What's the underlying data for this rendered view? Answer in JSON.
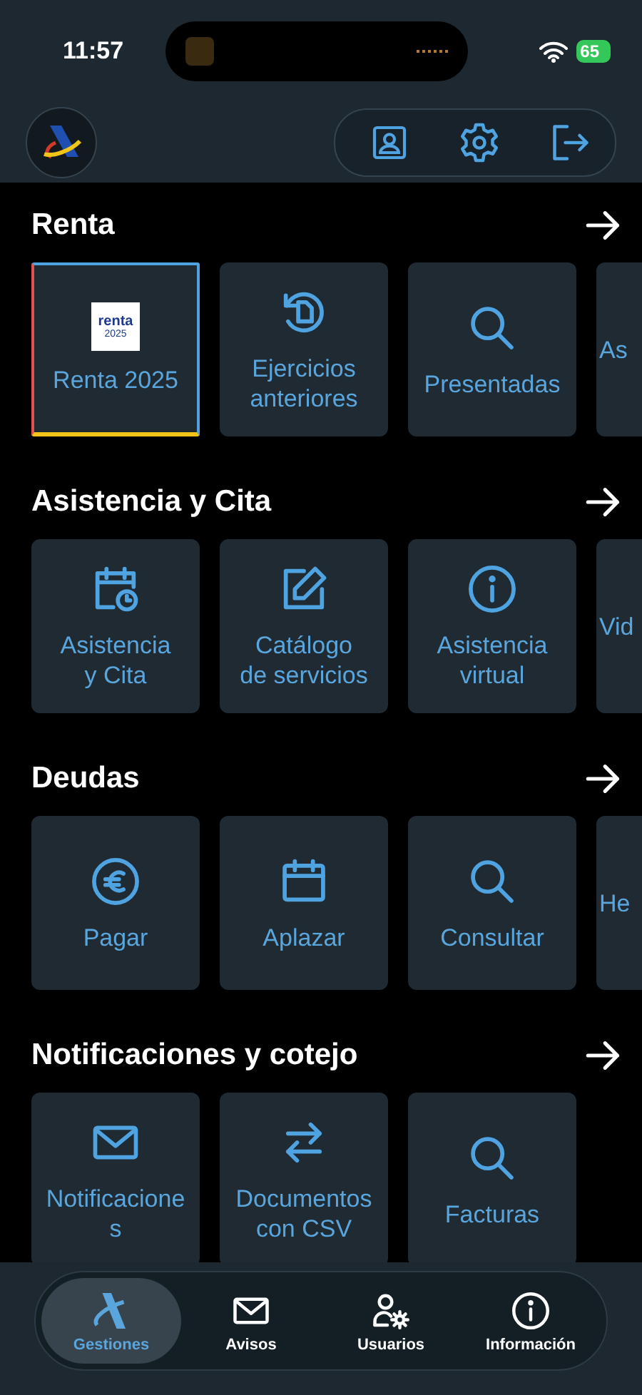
{
  "status_bar": {
    "time": "11:57",
    "battery": "65"
  },
  "sections": [
    {
      "title": "Renta",
      "tiles": [
        {
          "kind": "renta-logo",
          "logo": {
            "title": "renta",
            "year": "2025"
          },
          "lines": [
            "Renta 2025"
          ],
          "highlighted": true
        },
        {
          "kind": "history",
          "lines": [
            "Ejercicios",
            "anteriores"
          ],
          "highlighted": false
        },
        {
          "kind": "search",
          "lines": [
            "Presentadas"
          ],
          "highlighted": false
        },
        {
          "kind": "partial",
          "lines": [
            "As"
          ],
          "highlighted": false
        }
      ]
    },
    {
      "title": "Asistencia y Cita",
      "tiles": [
        {
          "kind": "calendar-clock",
          "lines": [
            "Asistencia",
            "y Cita"
          ],
          "highlighted": false
        },
        {
          "kind": "edit",
          "lines": [
            "Catálogo",
            "de servicios"
          ],
          "highlighted": false
        },
        {
          "kind": "info",
          "lines": [
            "Asistencia",
            "virtual"
          ],
          "highlighted": false
        },
        {
          "kind": "partial",
          "lines": [
            "Vid"
          ],
          "highlighted": false
        }
      ]
    },
    {
      "title": "Deudas",
      "tiles": [
        {
          "kind": "euro",
          "lines": [
            "Pagar"
          ],
          "highlighted": false
        },
        {
          "kind": "calendar",
          "lines": [
            "Aplazar"
          ],
          "highlighted": false
        },
        {
          "kind": "search",
          "lines": [
            "Consultar"
          ],
          "highlighted": false
        },
        {
          "kind": "partial",
          "lines": [
            "He"
          ],
          "highlighted": false
        }
      ]
    },
    {
      "title": "Notificaciones y cotejo",
      "tiles": [
        {
          "kind": "envelope",
          "lines": [
            "Notificacione",
            "s"
          ],
          "highlighted": false
        },
        {
          "kind": "swap",
          "lines": [
            "Documentos",
            "con CSV"
          ],
          "highlighted": false
        },
        {
          "kind": "search",
          "lines": [
            "Facturas"
          ],
          "highlighted": false
        }
      ]
    }
  ],
  "bottom_nav": [
    {
      "kind": "agency",
      "label": "Gestiones",
      "selected": true
    },
    {
      "kind": "envelope",
      "label": "Avisos",
      "selected": false
    },
    {
      "kind": "users",
      "label": "Usuarios",
      "selected": false
    },
    {
      "kind": "info",
      "label": "Información",
      "selected": false
    }
  ]
}
